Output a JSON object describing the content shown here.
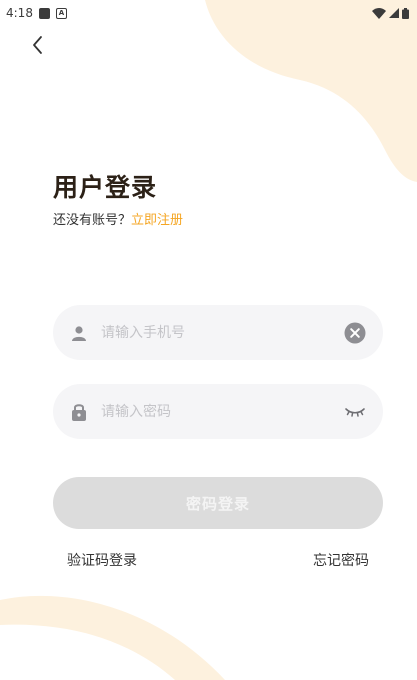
{
  "status_bar": {
    "time": "4:18",
    "icons": [
      "notification-square-icon",
      "a-badge-icon",
      "wifi-icon",
      "signal-icon",
      "battery-icon"
    ]
  },
  "header": {
    "back_icon": "chevron-left-icon"
  },
  "login": {
    "title": "用户登录",
    "no_account_text": "还没有账号？",
    "register_link": "立即注册"
  },
  "form": {
    "phone": {
      "placeholder": "请输入手机号",
      "value": "",
      "lead_icon": "user-icon",
      "trail_icon": "clear-icon"
    },
    "password": {
      "placeholder": "请输入密码",
      "value": "",
      "lead_icon": "lock-icon",
      "trail_icon": "eye-closed-icon"
    },
    "submit_label": "密码登录"
  },
  "footer": {
    "sms_login": "验证码登录",
    "forgot_password": "忘记密码"
  },
  "colors": {
    "accent": "#f5a623",
    "decoration": "#fdf1de",
    "input_bg": "#f5f5f7",
    "button_disabled": "#dcdcdc"
  }
}
